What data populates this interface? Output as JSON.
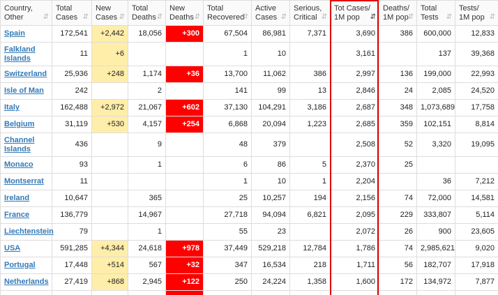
{
  "headers": [
    {
      "label": "Country,\nOther",
      "sorted": false
    },
    {
      "label": "Total\nCases",
      "sorted": false
    },
    {
      "label": "New\nCases",
      "sorted": false
    },
    {
      "label": "Total\nDeaths",
      "sorted": false
    },
    {
      "label": "New\nDeaths",
      "sorted": false
    },
    {
      "label": "Total\nRecovered",
      "sorted": false
    },
    {
      "label": "Active\nCases",
      "sorted": false
    },
    {
      "label": "Serious,\nCritical",
      "sorted": false
    },
    {
      "label": "Tot Cases/\n1M pop",
      "sorted": true
    },
    {
      "label": "Deaths/\n1M pop",
      "sorted": false
    },
    {
      "label": "Total\nTests",
      "sorted": false
    },
    {
      "label": "Tests/\n1M pop",
      "sorted": false
    }
  ],
  "sort_icons": {
    "unsorted": "⇵",
    "sorted": "⇵"
  },
  "colors": {
    "new_cases_bg": "#FFEEAA",
    "new_deaths_bg": "#FF0000",
    "link": "#337ab7",
    "highlight_border": "#e00000"
  },
  "rows": [
    {
      "country": "Spain",
      "total_cases": "172,541",
      "new_cases": "+2,442",
      "total_deaths": "18,056",
      "new_deaths": "+300",
      "total_recovered": "67,504",
      "active_cases": "86,981",
      "serious_critical": "7,371",
      "tot_cases_1m": "3,690",
      "deaths_1m": "386",
      "total_tests": "600,000",
      "tests_1m": "12,833",
      "tall": false
    },
    {
      "country": "Falkland\nIslands",
      "total_cases": "11",
      "new_cases": "+6",
      "total_deaths": "",
      "new_deaths": "",
      "total_recovered": "1",
      "active_cases": "10",
      "serious_critical": "",
      "tot_cases_1m": "3,161",
      "deaths_1m": "",
      "total_tests": "137",
      "tests_1m": "39,368",
      "tall": true
    },
    {
      "country": "Switzerland",
      "total_cases": "25,936",
      "new_cases": "+248",
      "total_deaths": "1,174",
      "new_deaths": "+36",
      "total_recovered": "13,700",
      "active_cases": "11,062",
      "serious_critical": "386",
      "tot_cases_1m": "2,997",
      "deaths_1m": "136",
      "total_tests": "199,000",
      "tests_1m": "22,993",
      "tall": false
    },
    {
      "country": "Isle of Man",
      "total_cases": "242",
      "new_cases": "",
      "total_deaths": "2",
      "new_deaths": "",
      "total_recovered": "141",
      "active_cases": "99",
      "serious_critical": "13",
      "tot_cases_1m": "2,846",
      "deaths_1m": "24",
      "total_tests": "2,085",
      "tests_1m": "24,520",
      "tall": false
    },
    {
      "country": "Italy",
      "total_cases": "162,488",
      "new_cases": "+2,972",
      "total_deaths": "21,067",
      "new_deaths": "+602",
      "total_recovered": "37,130",
      "active_cases": "104,291",
      "serious_critical": "3,186",
      "tot_cases_1m": "2,687",
      "deaths_1m": "348",
      "total_tests": "1,073,689",
      "tests_1m": "17,758",
      "tall": false
    },
    {
      "country": "Belgium",
      "total_cases": "31,119",
      "new_cases": "+530",
      "total_deaths": "4,157",
      "new_deaths": "+254",
      "total_recovered": "6,868",
      "active_cases": "20,094",
      "serious_critical": "1,223",
      "tot_cases_1m": "2,685",
      "deaths_1m": "359",
      "total_tests": "102,151",
      "tests_1m": "8,814",
      "tall": false
    },
    {
      "country": "Channel\nIslands",
      "total_cases": "436",
      "new_cases": "",
      "total_deaths": "9",
      "new_deaths": "",
      "total_recovered": "48",
      "active_cases": "379",
      "serious_critical": "",
      "tot_cases_1m": "2,508",
      "deaths_1m": "52",
      "total_tests": "3,320",
      "tests_1m": "19,095",
      "tall": true
    },
    {
      "country": "Monaco",
      "total_cases": "93",
      "new_cases": "",
      "total_deaths": "1",
      "new_deaths": "",
      "total_recovered": "6",
      "active_cases": "86",
      "serious_critical": "5",
      "tot_cases_1m": "2,370",
      "deaths_1m": "25",
      "total_tests": "",
      "tests_1m": "",
      "tall": false
    },
    {
      "country": "Montserrat",
      "total_cases": "11",
      "new_cases": "",
      "total_deaths": "",
      "new_deaths": "",
      "total_recovered": "1",
      "active_cases": "10",
      "serious_critical": "1",
      "tot_cases_1m": "2,204",
      "deaths_1m": "",
      "total_tests": "36",
      "tests_1m": "7,212",
      "tall": false
    },
    {
      "country": "Ireland",
      "total_cases": "10,647",
      "new_cases": "",
      "total_deaths": "365",
      "new_deaths": "",
      "total_recovered": "25",
      "active_cases": "10,257",
      "serious_critical": "194",
      "tot_cases_1m": "2,156",
      "deaths_1m": "74",
      "total_tests": "72,000",
      "tests_1m": "14,581",
      "tall": false
    },
    {
      "country": "France",
      "total_cases": "136,779",
      "new_cases": "",
      "total_deaths": "14,967",
      "new_deaths": "",
      "total_recovered": "27,718",
      "active_cases": "94,094",
      "serious_critical": "6,821",
      "tot_cases_1m": "2,095",
      "deaths_1m": "229",
      "total_tests": "333,807",
      "tests_1m": "5,114",
      "tall": false
    },
    {
      "country": "Liechtenstein",
      "total_cases": "79",
      "new_cases": "",
      "total_deaths": "1",
      "new_deaths": "",
      "total_recovered": "55",
      "active_cases": "23",
      "serious_critical": "",
      "tot_cases_1m": "2,072",
      "deaths_1m": "26",
      "total_tests": "900",
      "tests_1m": "23,605",
      "tall": false
    },
    {
      "country": "USA",
      "total_cases": "591,285",
      "new_cases": "+4,344",
      "total_deaths": "24,618",
      "new_deaths": "+978",
      "total_recovered": "37,449",
      "active_cases": "529,218",
      "serious_critical": "12,784",
      "tot_cases_1m": "1,786",
      "deaths_1m": "74",
      "total_tests": "2,985,621",
      "tests_1m": "9,020",
      "tall": false
    },
    {
      "country": "Portugal",
      "total_cases": "17,448",
      "new_cases": "+514",
      "total_deaths": "567",
      "new_deaths": "+32",
      "total_recovered": "347",
      "active_cases": "16,534",
      "serious_critical": "218",
      "tot_cases_1m": "1,711",
      "deaths_1m": "56",
      "total_tests": "182,707",
      "tests_1m": "17,918",
      "tall": false
    },
    {
      "country": "Netherlands",
      "total_cases": "27,419",
      "new_cases": "+868",
      "total_deaths": "2,945",
      "new_deaths": "+122",
      "total_recovered": "250",
      "active_cases": "24,224",
      "serious_critical": "1,358",
      "tot_cases_1m": "1,600",
      "deaths_1m": "172",
      "total_tests": "134,972",
      "tests_1m": "7,877",
      "tall": false
    },
    {
      "country": "",
      "total_cases": "",
      "new_cases": "",
      "total_deaths": "",
      "new_deaths": "",
      "total_recovered": "",
      "active_cases": "",
      "serious_critical": "",
      "tot_cases_1m": "",
      "deaths_1m": "",
      "total_tests": "",
      "tests_1m": "",
      "tall": false
    }
  ]
}
